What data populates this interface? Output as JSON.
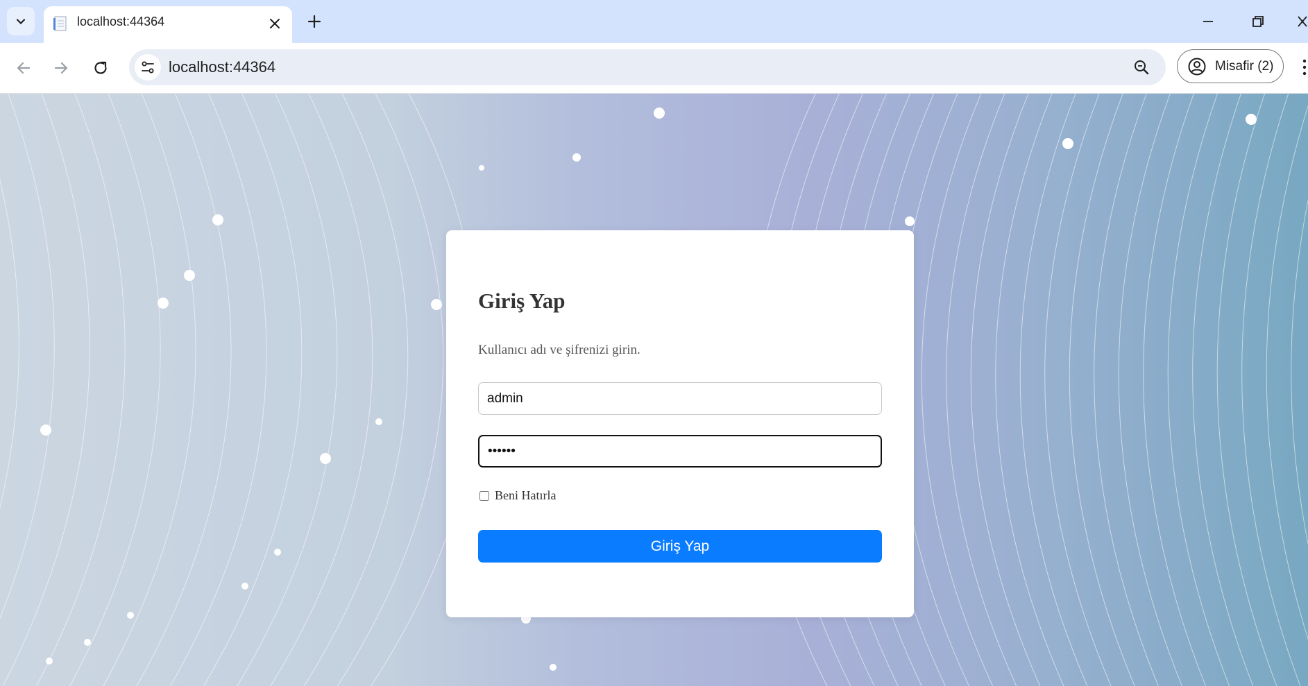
{
  "browser": {
    "tab": {
      "title": "localhost:44364"
    },
    "address_bar": {
      "url": "localhost:44364"
    },
    "profile": {
      "label": "Misafir (2)"
    }
  },
  "login": {
    "title": "Giriş Yap",
    "subtitle": "Kullanıcı adı ve şifrenizi girin.",
    "username_value": "admin",
    "password_value": "••••••",
    "remember_label": "Beni Hatırla",
    "remember_checked": false,
    "submit_label": "Giriş Yap"
  },
  "colors": {
    "accent": "#0a7cff",
    "chrome_tabbar": "#d3e3fd"
  }
}
